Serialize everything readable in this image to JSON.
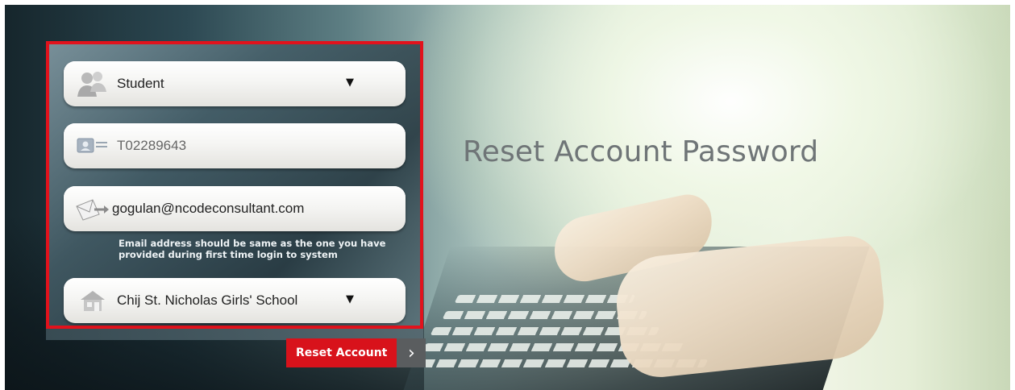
{
  "page": {
    "title": "Reset Account Password"
  },
  "form": {
    "user_type": {
      "selected": "Student",
      "icon": "users-icon"
    },
    "user_id": {
      "value": "T02289643",
      "icon": "id-card-icon"
    },
    "email": {
      "value": "gogulan@ncodeconsultant.com",
      "icon": "envelope-icon",
      "hint": "Email address should be same as the one you have provided during first time login to system"
    },
    "school": {
      "selected": "Chij St. Nicholas Girls' School",
      "icon": "house-icon"
    },
    "submit": {
      "label": "Reset Account",
      "arrow": "›"
    }
  },
  "colors": {
    "accent_red": "#d8121b",
    "panel_border": "#e2121c",
    "title_gray": "#6f7577"
  }
}
